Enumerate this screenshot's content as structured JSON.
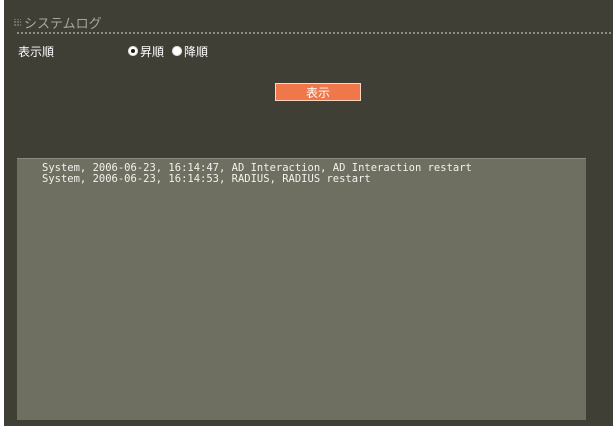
{
  "header": {
    "icon": "grid-icon",
    "title": "システムログ"
  },
  "order": {
    "label": "表示順",
    "options": [
      {
        "label": "昇順",
        "checked": true
      },
      {
        "label": "降順",
        "checked": false
      }
    ]
  },
  "show_button": {
    "label": "表示"
  },
  "log": {
    "lines": [
      "System, 2006-06-23, 16:14:47, AD Interaction, AD Interaction restart",
      "System, 2006-06-23, 16:14:53, RADIUS, RADIUS restart"
    ]
  },
  "colors": {
    "background": "#3f3f35",
    "log_panel": "#6e6f60",
    "button": "#f0774a",
    "header_text": "#a7a89a"
  }
}
